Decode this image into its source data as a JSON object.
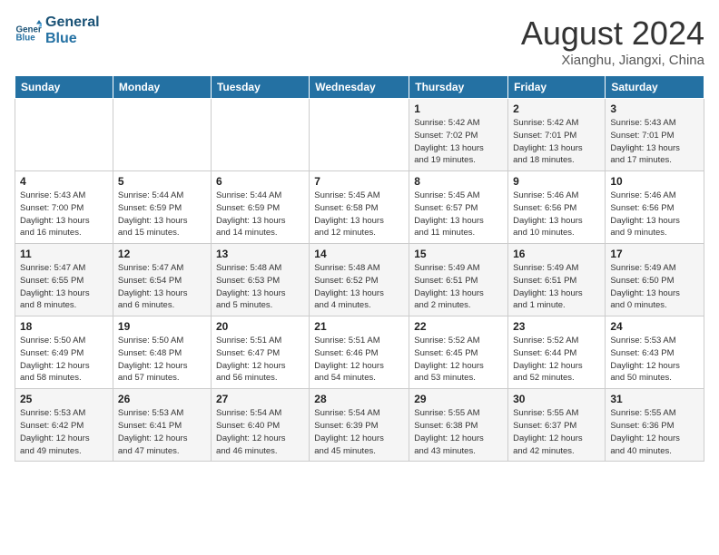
{
  "header": {
    "logo_line1": "General",
    "logo_line2": "Blue",
    "month": "August 2024",
    "location": "Xianghu, Jiangxi, China"
  },
  "days_of_week": [
    "Sunday",
    "Monday",
    "Tuesday",
    "Wednesday",
    "Thursday",
    "Friday",
    "Saturday"
  ],
  "weeks": [
    [
      {
        "day": "",
        "info": ""
      },
      {
        "day": "",
        "info": ""
      },
      {
        "day": "",
        "info": ""
      },
      {
        "day": "",
        "info": ""
      },
      {
        "day": "1",
        "info": "Sunrise: 5:42 AM\nSunset: 7:02 PM\nDaylight: 13 hours\nand 19 minutes."
      },
      {
        "day": "2",
        "info": "Sunrise: 5:42 AM\nSunset: 7:01 PM\nDaylight: 13 hours\nand 18 minutes."
      },
      {
        "day": "3",
        "info": "Sunrise: 5:43 AM\nSunset: 7:01 PM\nDaylight: 13 hours\nand 17 minutes."
      }
    ],
    [
      {
        "day": "4",
        "info": "Sunrise: 5:43 AM\nSunset: 7:00 PM\nDaylight: 13 hours\nand 16 minutes."
      },
      {
        "day": "5",
        "info": "Sunrise: 5:44 AM\nSunset: 6:59 PM\nDaylight: 13 hours\nand 15 minutes."
      },
      {
        "day": "6",
        "info": "Sunrise: 5:44 AM\nSunset: 6:59 PM\nDaylight: 13 hours\nand 14 minutes."
      },
      {
        "day": "7",
        "info": "Sunrise: 5:45 AM\nSunset: 6:58 PM\nDaylight: 13 hours\nand 12 minutes."
      },
      {
        "day": "8",
        "info": "Sunrise: 5:45 AM\nSunset: 6:57 PM\nDaylight: 13 hours\nand 11 minutes."
      },
      {
        "day": "9",
        "info": "Sunrise: 5:46 AM\nSunset: 6:56 PM\nDaylight: 13 hours\nand 10 minutes."
      },
      {
        "day": "10",
        "info": "Sunrise: 5:46 AM\nSunset: 6:56 PM\nDaylight: 13 hours\nand 9 minutes."
      }
    ],
    [
      {
        "day": "11",
        "info": "Sunrise: 5:47 AM\nSunset: 6:55 PM\nDaylight: 13 hours\nand 8 minutes."
      },
      {
        "day": "12",
        "info": "Sunrise: 5:47 AM\nSunset: 6:54 PM\nDaylight: 13 hours\nand 6 minutes."
      },
      {
        "day": "13",
        "info": "Sunrise: 5:48 AM\nSunset: 6:53 PM\nDaylight: 13 hours\nand 5 minutes."
      },
      {
        "day": "14",
        "info": "Sunrise: 5:48 AM\nSunset: 6:52 PM\nDaylight: 13 hours\nand 4 minutes."
      },
      {
        "day": "15",
        "info": "Sunrise: 5:49 AM\nSunset: 6:51 PM\nDaylight: 13 hours\nand 2 minutes."
      },
      {
        "day": "16",
        "info": "Sunrise: 5:49 AM\nSunset: 6:51 PM\nDaylight: 13 hours\nand 1 minute."
      },
      {
        "day": "17",
        "info": "Sunrise: 5:49 AM\nSunset: 6:50 PM\nDaylight: 13 hours\nand 0 minutes."
      }
    ],
    [
      {
        "day": "18",
        "info": "Sunrise: 5:50 AM\nSunset: 6:49 PM\nDaylight: 12 hours\nand 58 minutes."
      },
      {
        "day": "19",
        "info": "Sunrise: 5:50 AM\nSunset: 6:48 PM\nDaylight: 12 hours\nand 57 minutes."
      },
      {
        "day": "20",
        "info": "Sunrise: 5:51 AM\nSunset: 6:47 PM\nDaylight: 12 hours\nand 56 minutes."
      },
      {
        "day": "21",
        "info": "Sunrise: 5:51 AM\nSunset: 6:46 PM\nDaylight: 12 hours\nand 54 minutes."
      },
      {
        "day": "22",
        "info": "Sunrise: 5:52 AM\nSunset: 6:45 PM\nDaylight: 12 hours\nand 53 minutes."
      },
      {
        "day": "23",
        "info": "Sunrise: 5:52 AM\nSunset: 6:44 PM\nDaylight: 12 hours\nand 52 minutes."
      },
      {
        "day": "24",
        "info": "Sunrise: 5:53 AM\nSunset: 6:43 PM\nDaylight: 12 hours\nand 50 minutes."
      }
    ],
    [
      {
        "day": "25",
        "info": "Sunrise: 5:53 AM\nSunset: 6:42 PM\nDaylight: 12 hours\nand 49 minutes."
      },
      {
        "day": "26",
        "info": "Sunrise: 5:53 AM\nSunset: 6:41 PM\nDaylight: 12 hours\nand 47 minutes."
      },
      {
        "day": "27",
        "info": "Sunrise: 5:54 AM\nSunset: 6:40 PM\nDaylight: 12 hours\nand 46 minutes."
      },
      {
        "day": "28",
        "info": "Sunrise: 5:54 AM\nSunset: 6:39 PM\nDaylight: 12 hours\nand 45 minutes."
      },
      {
        "day": "29",
        "info": "Sunrise: 5:55 AM\nSunset: 6:38 PM\nDaylight: 12 hours\nand 43 minutes."
      },
      {
        "day": "30",
        "info": "Sunrise: 5:55 AM\nSunset: 6:37 PM\nDaylight: 12 hours\nand 42 minutes."
      },
      {
        "day": "31",
        "info": "Sunrise: 5:55 AM\nSunset: 6:36 PM\nDaylight: 12 hours\nand 40 minutes."
      }
    ]
  ]
}
